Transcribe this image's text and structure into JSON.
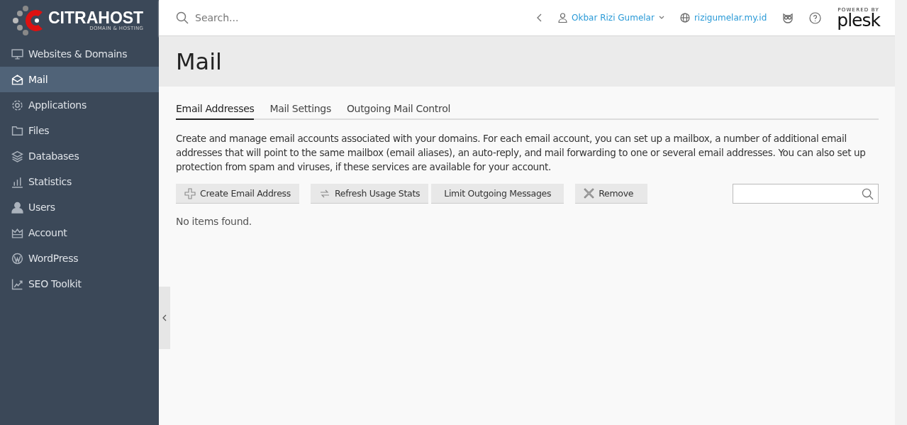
{
  "logo": {
    "name": "CITRAHOST",
    "tagline": "DOMAIN & HOSTING"
  },
  "sidebar": {
    "items": [
      {
        "label": "Websites & Domains",
        "kind": "monitor",
        "selected": false
      },
      {
        "label": "Mail",
        "kind": "mail",
        "selected": true
      },
      {
        "label": "Applications",
        "kind": "gear",
        "selected": false
      },
      {
        "label": "Files",
        "kind": "folder",
        "selected": false
      },
      {
        "label": "Databases",
        "kind": "layers",
        "selected": false
      },
      {
        "label": "Statistics",
        "kind": "bars",
        "selected": false
      },
      {
        "label": "Users",
        "kind": "user",
        "selected": false
      },
      {
        "label": "Account",
        "kind": "crown",
        "selected": false
      },
      {
        "label": "WordPress",
        "kind": "wp",
        "selected": false
      },
      {
        "label": "SEO Toolkit",
        "kind": "chart",
        "selected": false
      }
    ]
  },
  "header": {
    "search": {
      "placeholder": "Search..."
    },
    "user": "Okbar Rizi Gumelar",
    "domain": "rizigumelar.my.id",
    "powered": {
      "caption": "POWERED BY",
      "brand": "plesk"
    }
  },
  "page": {
    "title": "Mail"
  },
  "tabs": [
    {
      "label": "Email Addresses",
      "selected": true
    },
    {
      "label": "Mail Settings",
      "selected": false
    },
    {
      "label": "Outgoing Mail Control",
      "selected": false
    }
  ],
  "description": "Create and manage email accounts associated with your domains. For each email account, you can set up a mailbox, a number of additional email addresses that will point to the same mailbox (email aliases), an auto-reply, and mail forwarding to one or several email addresses. You can also set up protection from spam and viruses, if these services are available for your account.",
  "toolbar": [
    {
      "label": "Create Email Address",
      "kind": "plus"
    },
    {
      "label": "Refresh Usage Stats",
      "kind": "refresh"
    },
    {
      "label": "Limit Outgoing Messages",
      "kind": "plain"
    },
    {
      "label": "Remove",
      "kind": "cross"
    }
  ],
  "empty_message": "No items found."
}
